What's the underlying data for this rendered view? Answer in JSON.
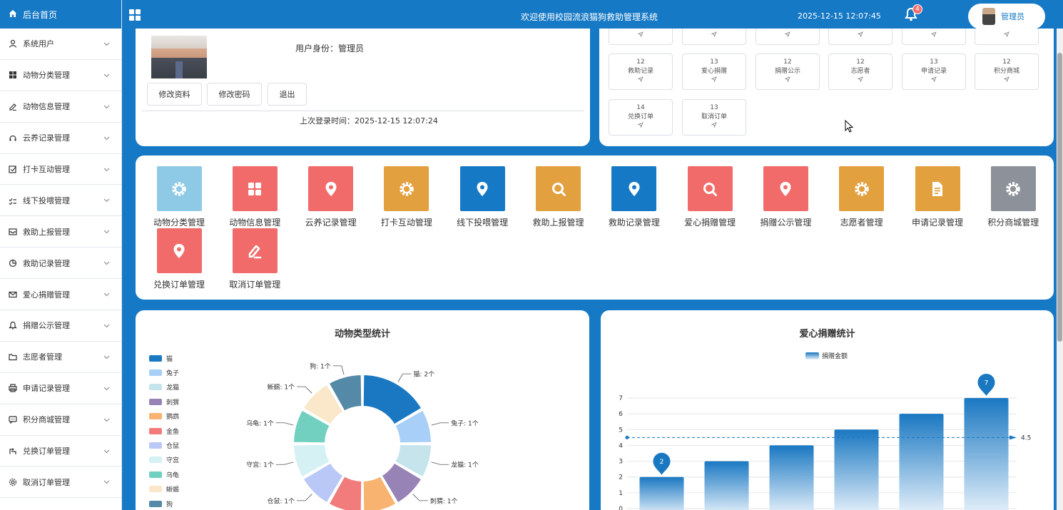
{
  "sidebar": {
    "home": "后台首页",
    "items": [
      {
        "label": "系统用户",
        "icon": "user-icon"
      },
      {
        "label": "动物分类管理",
        "icon": "grid-icon"
      },
      {
        "label": "动物信息管理",
        "icon": "edit-icon"
      },
      {
        "label": "云养记录管理",
        "icon": "headset-icon"
      },
      {
        "label": "打卡互动管理",
        "icon": "check-square-icon"
      },
      {
        "label": "线下投喂管理",
        "icon": "checklist-icon"
      },
      {
        "label": "救助上报管理",
        "icon": "inbox-icon"
      },
      {
        "label": "救助记录管理",
        "icon": "pie-icon"
      },
      {
        "label": "爱心捐赠管理",
        "icon": "mail-icon"
      },
      {
        "label": "捐赠公示管理",
        "icon": "bell-icon"
      },
      {
        "label": "志愿者管理",
        "icon": "folder-icon"
      },
      {
        "label": "申请记录管理",
        "icon": "printer-icon"
      },
      {
        "label": "积分商城管理",
        "icon": "chat-icon"
      },
      {
        "label": "兑换订单管理",
        "icon": "share-icon"
      },
      {
        "label": "取消订单管理",
        "icon": "gear-icon"
      }
    ]
  },
  "header": {
    "title": "欢迎使用校园流浪猫狗救助管理系统",
    "datetime": "2025-12-15 12:07:45",
    "notifications": "4",
    "user": "管理员"
  },
  "profile": {
    "identity": "用户身份：管理员",
    "edit_btn": "修改资料",
    "pwd_btn": "修改密码",
    "logout_btn": "退出",
    "last_login": "上次登录时间：2025-12-15 12:07:24"
  },
  "menu_tiles": [
    {
      "count": "12",
      "label": "救助记录"
    },
    {
      "count": "13",
      "label": "爱心捐赠"
    },
    {
      "count": "12",
      "label": "捐赠公示"
    },
    {
      "count": "12",
      "label": "志愿者"
    },
    {
      "count": "13",
      "label": "申请记录"
    },
    {
      "count": "12",
      "label": "积分商城"
    },
    {
      "count": "14",
      "label": "兑换订单"
    },
    {
      "count": "13",
      "label": "取消订单"
    }
  ],
  "quick_links": [
    {
      "label": "动物分类管理",
      "color": "#8ecae6",
      "icon": "gear-icon"
    },
    {
      "label": "动物信息管理",
      "color": "#f26b6b",
      "icon": "grid-icon"
    },
    {
      "label": "云养记录管理",
      "color": "#f26b6b",
      "icon": "location-icon"
    },
    {
      "label": "打卡互动管理",
      "color": "#e2a03f",
      "icon": "gear-icon"
    },
    {
      "label": "线下投喂管理",
      "color": "#1679c5",
      "icon": "location-icon"
    },
    {
      "label": "救助上报管理",
      "color": "#e2a03f",
      "icon": "search-icon"
    },
    {
      "label": "救助记录管理",
      "color": "#1679c5",
      "icon": "location-icon"
    },
    {
      "label": "爱心捐赠管理",
      "color": "#f26b6b",
      "icon": "search-icon"
    },
    {
      "label": "捐赠公示管理",
      "color": "#f26b6b",
      "icon": "location-icon"
    },
    {
      "label": "志愿者管理",
      "color": "#e2a03f",
      "icon": "gear-icon"
    },
    {
      "label": "申请记录管理",
      "color": "#e2a03f",
      "icon": "document-icon"
    },
    {
      "label": "积分商城管理",
      "color": "#8d9199",
      "icon": "gear-icon"
    },
    {
      "label": "兑换订单管理",
      "color": "#f26b6b",
      "icon": "location-icon"
    },
    {
      "label": "取消订单管理",
      "color": "#f26b6b",
      "icon": "edit-icon"
    }
  ],
  "chart_data": [
    {
      "type": "pie",
      "title": "动物类型统计",
      "legend_position": "left",
      "slices": [
        {
          "name": "猫",
          "value": 2,
          "label": "猫: 2个",
          "color": "#1a78c2"
        },
        {
          "name": "兔子",
          "value": 1,
          "label": "兔子: 1个",
          "color": "#a7cff7"
        },
        {
          "name": "龙猫",
          "value": 1,
          "label": "龙猫: 1个",
          "color": "#c5e4ec"
        },
        {
          "name": "刺猬",
          "value": 1,
          "label": "刺猬: 1个",
          "color": "#9783b5"
        },
        {
          "name": "鹦鹉",
          "value": 1,
          "label": "",
          "color": "#f7b36f"
        },
        {
          "name": "金鱼",
          "value": 1,
          "label": "",
          "color": "#f27b7b"
        },
        {
          "name": "仓鼠",
          "value": 1,
          "label": "仓鼠: 1个",
          "color": "#b9c8f7"
        },
        {
          "name": "守宫",
          "value": 1,
          "label": "守宫: 1个",
          "color": "#d6f1f4"
        },
        {
          "name": "乌龟",
          "value": 1,
          "label": "乌龟: 1个",
          "color": "#71d0bf"
        },
        {
          "name": "蜥蜴",
          "value": 1,
          "label": "蜥蜴: 1个",
          "color": "#fbe7c9"
        },
        {
          "name": "狗",
          "value": 1,
          "label": "狗: 1个",
          "color": "#5589a8"
        }
      ]
    },
    {
      "type": "bar",
      "title": "爱心捐赠统计",
      "legend_position": "top",
      "series": [
        {
          "name": "捐赠金额",
          "values": [
            2,
            3,
            4,
            5,
            6,
            7
          ]
        }
      ],
      "ylim": [
        0,
        7
      ],
      "yticks": [
        "0",
        "1",
        "2",
        "3",
        "4",
        "5",
        "6",
        "7"
      ],
      "average": 4.5,
      "average_label": "4.5",
      "max_label": "7",
      "min_label": "2",
      "color": "#1a78c2"
    }
  ]
}
